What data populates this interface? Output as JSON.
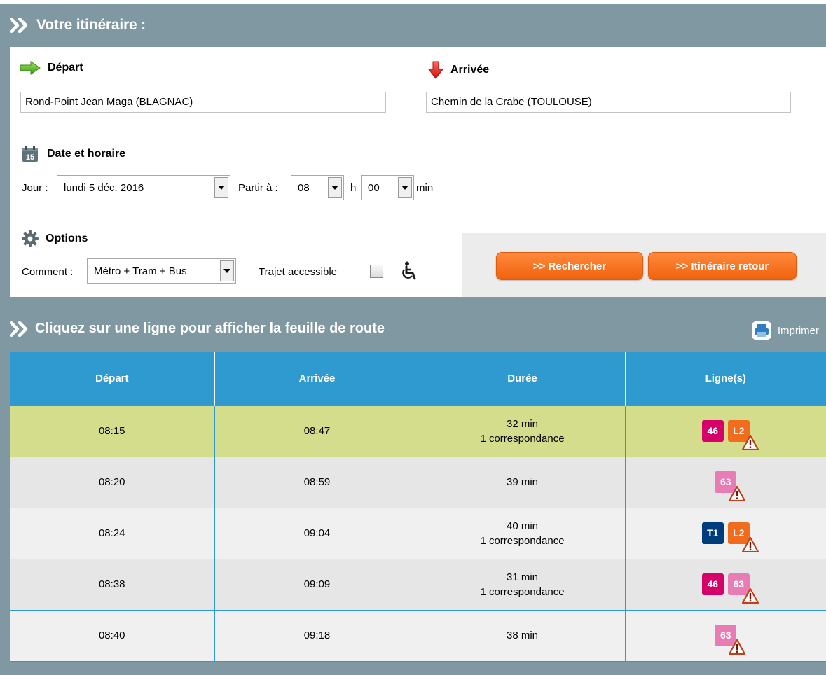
{
  "itinerary": {
    "title": "Votre itinéraire :",
    "departure": {
      "label": "Départ",
      "value": "Rond-Point Jean Maga (BLAGNAC)"
    },
    "arrival": {
      "label": "Arrivée",
      "value": "Chemin de la Crabe (TOULOUSE)"
    },
    "datetime": {
      "label": "Date et horaire",
      "day_label": "Jour :",
      "day_value": "lundi 5 déc. 2016",
      "leave_label": "Partir à :",
      "hour_value": "08",
      "hour_unit": "h",
      "minute_value": "00",
      "minute_unit": "min"
    },
    "options": {
      "label": "Options",
      "how_label": "Comment :",
      "how_value": "Métro + Tram + Bus",
      "accessible_label": "Trajet accessible",
      "accessible_checked": false
    },
    "buttons": {
      "search": ">> Rechercher",
      "return": ">> Itinéraire retour"
    }
  },
  "results": {
    "title": "Cliquez sur une ligne pour afficher la feuille de route",
    "print_label": "Imprimer",
    "columns": [
      "Départ",
      "Arrivée",
      "Durée",
      "Ligne(s)"
    ],
    "rows": [
      {
        "departure": "08:15",
        "arrival": "08:47",
        "duration": "32 min",
        "transfer": "1 correspondance",
        "lines": [
          {
            "name": "46",
            "color": "#d6006b",
            "warning": false
          },
          {
            "name": "L2",
            "color": "#f26c1d",
            "warning": true
          }
        ]
      },
      {
        "departure": "08:20",
        "arrival": "08:59",
        "duration": "39 min",
        "transfer": "",
        "lines": [
          {
            "name": "63",
            "color": "#e87db5",
            "warning": true
          }
        ]
      },
      {
        "departure": "08:24",
        "arrival": "09:04",
        "duration": "40 min",
        "transfer": "1 correspondance",
        "lines": [
          {
            "name": "T1",
            "color": "#003d7c",
            "warning": false
          },
          {
            "name": "L2",
            "color": "#f26c1d",
            "warning": true
          }
        ]
      },
      {
        "departure": "08:38",
        "arrival": "09:09",
        "duration": "31 min",
        "transfer": "1 correspondance",
        "lines": [
          {
            "name": "46",
            "color": "#d6006b",
            "warning": false
          },
          {
            "name": "63",
            "color": "#e87db5",
            "warning": true
          }
        ]
      },
      {
        "departure": "08:40",
        "arrival": "09:18",
        "duration": "38 min",
        "transfer": "",
        "lines": [
          {
            "name": "63",
            "color": "#e87db5",
            "warning": true
          }
        ]
      }
    ]
  },
  "colors": {
    "frame": "#7f98a2",
    "table_header": "#2f9acf",
    "selected_row": "#d4dd8c",
    "button": "#f26c1d"
  },
  "icons": {
    "header": "double-chevron-icon",
    "departure": "green-arrow-right-icon",
    "arrival": "red-arrow-down-icon",
    "datetime": "calendar-icon",
    "options": "gear-icon",
    "accessible": "wheelchair-icon",
    "print": "printer-icon",
    "line_alert": "warning-icon"
  }
}
